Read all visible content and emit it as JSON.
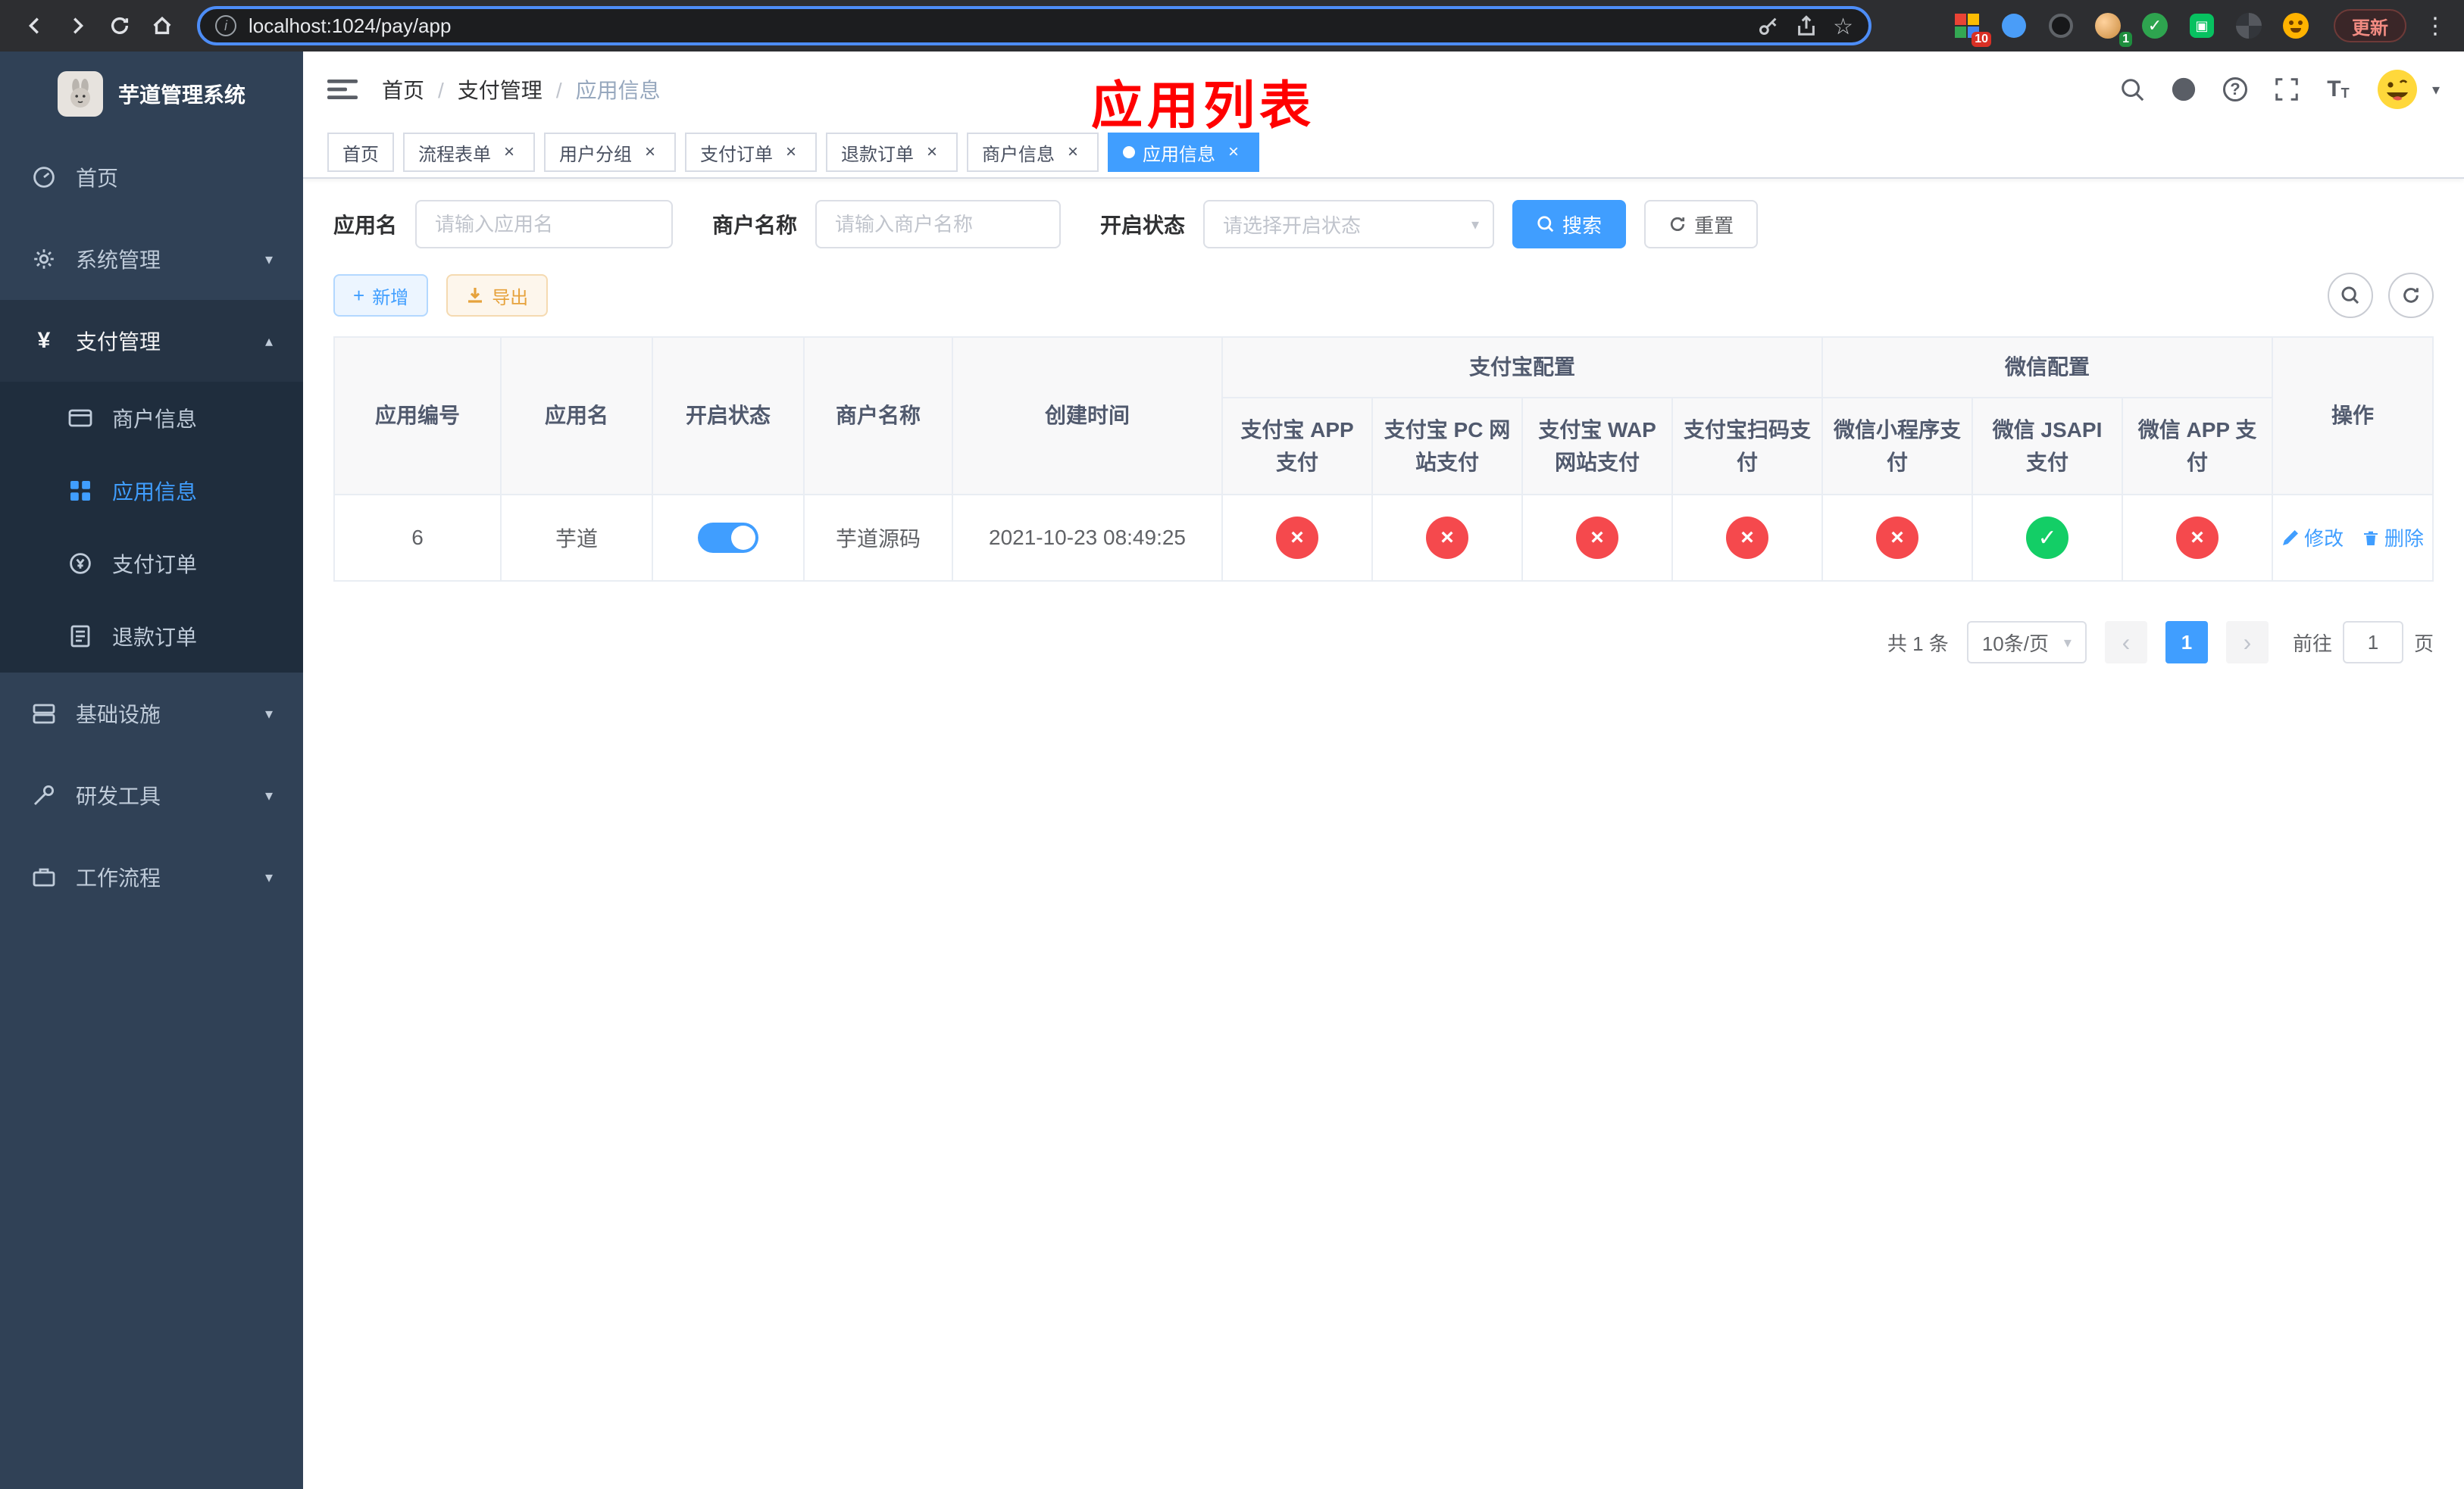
{
  "browser": {
    "url": "localhost:1024/pay/app",
    "update_button": "更新",
    "ext_badge_grid": "10",
    "ext_badge_avatar": "1"
  },
  "sidebar": {
    "app_title": "芋道管理系统",
    "menu": [
      {
        "label": "首页"
      },
      {
        "label": "系统管理"
      },
      {
        "label": "支付管理"
      },
      {
        "label": "基础设施"
      },
      {
        "label": "研发工具"
      },
      {
        "label": "工作流程"
      }
    ],
    "submenu": [
      {
        "label": "商户信息"
      },
      {
        "label": "应用信息"
      },
      {
        "label": "支付订单"
      },
      {
        "label": "退款订单"
      }
    ]
  },
  "navbar": {
    "breadcrumb": [
      "首页",
      "支付管理",
      "应用信息"
    ],
    "overlay_title": "应用列表"
  },
  "tabs": [
    {
      "label": "首页"
    },
    {
      "label": "流程表单"
    },
    {
      "label": "用户分组"
    },
    {
      "label": "支付订单"
    },
    {
      "label": "退款订单"
    },
    {
      "label": "商户信息"
    },
    {
      "label": "应用信息"
    }
  ],
  "filters": {
    "app_name_label": "应用名",
    "app_name_placeholder": "请输入应用名",
    "merchant_label": "商户名称",
    "merchant_placeholder": "请输入商户名称",
    "status_label": "开启状态",
    "status_placeholder": "请选择开启状态",
    "search_button": "搜索",
    "reset_button": "重置"
  },
  "toolbar": {
    "add_button": "新增",
    "export_button": "导出"
  },
  "table": {
    "headers": {
      "app_id": "应用编号",
      "app_name": "应用名",
      "status": "开启状态",
      "merchant": "商户名称",
      "created": "创建时间",
      "alipay_group": "支付宝配置",
      "wechat_group": "微信配置",
      "actions": "操作",
      "channels": [
        "支付宝 APP 支付",
        "支付宝 PC 网站支付",
        "支付宝 WAP 网站支付",
        "支付宝扫码支付",
        "微信小程序支付",
        "微信 JSAPI 支付",
        "微信 APP 支付"
      ]
    },
    "rows": [
      {
        "app_id": "6",
        "app_name": "芋道",
        "enabled": true,
        "merchant": "芋道源码",
        "created": "2021-10-23 08:49:25",
        "channels": [
          "disabled",
          "disabled",
          "disabled",
          "disabled",
          "disabled",
          "enabled",
          "disabled"
        ],
        "edit": "修改",
        "delete": "删除"
      }
    ]
  },
  "pagination": {
    "total": "共 1 条",
    "page_size": "10条/页",
    "current_page": "1",
    "goto_label": "前往",
    "goto_value": "1",
    "goto_suffix": "页"
  },
  "colors": {
    "primary": "#409eff",
    "danger": "#f5494d",
    "success": "#13ce66",
    "sidebar_bg": "#304156",
    "submenu_bg": "#1f2d3d",
    "annotation_red": "#ff0000"
  }
}
